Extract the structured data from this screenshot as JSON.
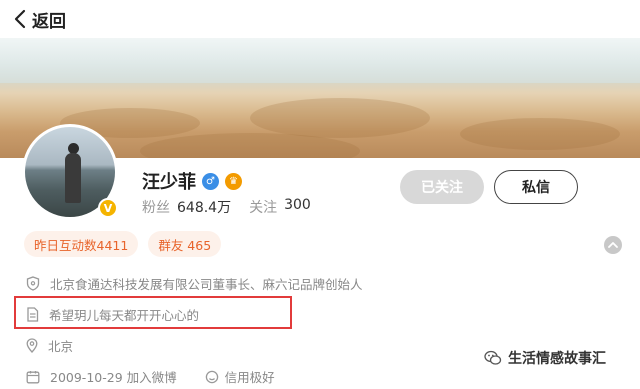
{
  "nav": {
    "back_label": "返回"
  },
  "profile": {
    "name": "汪少菲",
    "stats": [
      {
        "label": "粉丝",
        "value": "648.4万"
      },
      {
        "label": "关注",
        "value": "300"
      }
    ]
  },
  "actions": {
    "followed_label": "已关注",
    "message_label": "私信"
  },
  "tags": [
    {
      "label": "昨日互动数4411"
    },
    {
      "label": "群友 465"
    }
  ],
  "info": {
    "bio": "北京食通达科技发展有限公司董事长、麻六记品牌创始人",
    "signature": "希望玥儿每天都开开心心的",
    "location": "北京",
    "join_date": "2009-10-29 加入微博",
    "credit": "信用极好"
  },
  "watermark": {
    "text": "生活情感故事汇"
  },
  "colors": {
    "accent": "#e8642b",
    "highlight_border": "#e23b3b",
    "verified_gold": "#f5b400"
  }
}
